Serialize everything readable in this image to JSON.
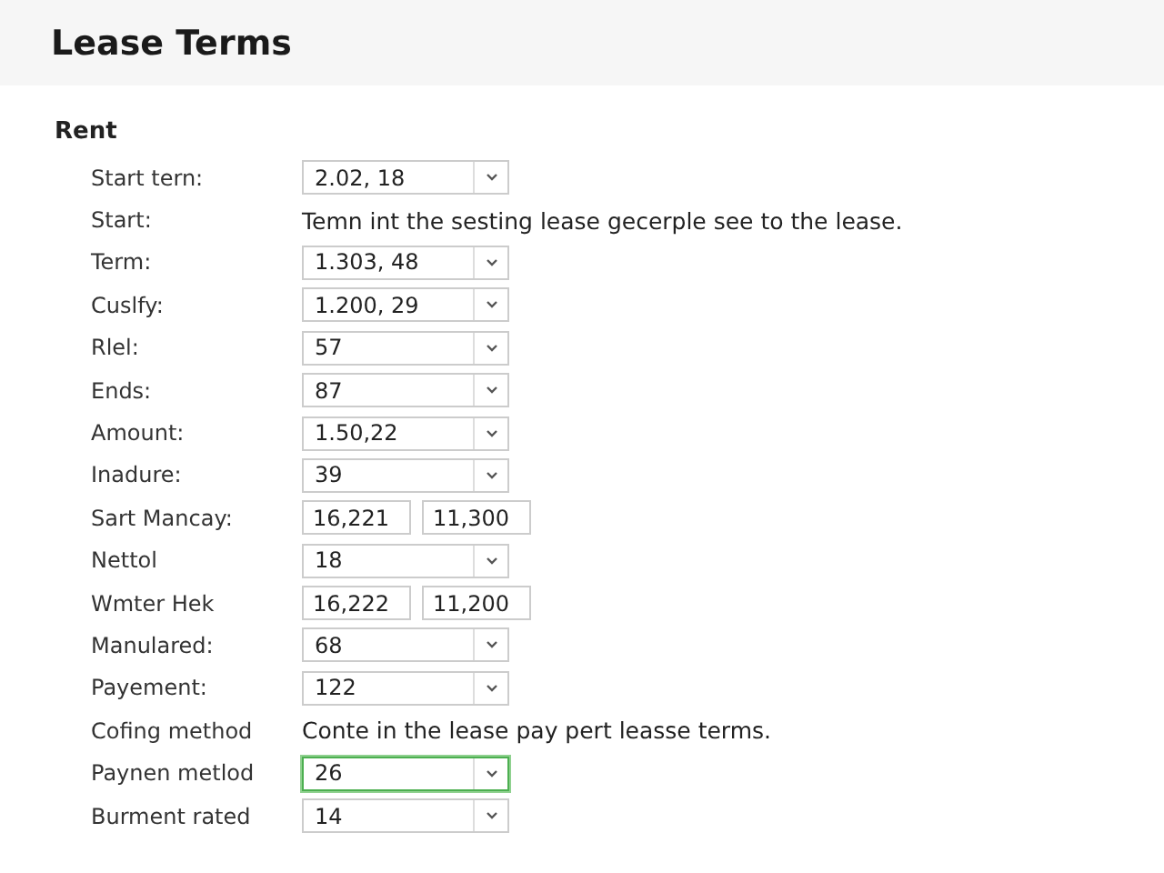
{
  "title": "Lease Terms",
  "section": "Rent",
  "rows": [
    {
      "label": "Start tern:",
      "kind": "select",
      "value": "2.02, 18",
      "focused": false
    },
    {
      "label": "Start:",
      "kind": "text",
      "value": "Temn int the sesting lease gecerple see to the lease."
    },
    {
      "label": "Term:",
      "kind": "select",
      "value": "1.303, 48",
      "focused": false
    },
    {
      "label": "Cuslfy:",
      "kind": "select",
      "value": "1.200, 29",
      "focused": false
    },
    {
      "label": "Rlel:",
      "kind": "select",
      "value": "57",
      "focused": false
    },
    {
      "label": "Ends:",
      "kind": "select",
      "value": "87",
      "focused": false
    },
    {
      "label": "Amount:",
      "kind": "select",
      "value": "1.50,22",
      "focused": false
    },
    {
      "label": "Inadure:",
      "kind": "select",
      "value": "39",
      "focused": false
    },
    {
      "label": "Sart Mancay:",
      "kind": "pair",
      "values": [
        "16,221",
        "11,300"
      ]
    },
    {
      "label": "Nettol",
      "kind": "select",
      "value": "18",
      "focused": false
    },
    {
      "label": "Wmter Hek",
      "kind": "pair",
      "values": [
        "16,222",
        "11,200"
      ]
    },
    {
      "label": "Manulared:",
      "kind": "select",
      "value": "68",
      "focused": false
    },
    {
      "label": "Payement:",
      "kind": "select",
      "value": "122",
      "focused": false
    },
    {
      "label": "Cofing method",
      "kind": "text",
      "value": "Conte in the lease pay pert leasse terms."
    },
    {
      "label": "Paynen metlod",
      "kind": "select",
      "value": "26",
      "focused": true
    },
    {
      "label": "Burment rated",
      "kind": "select",
      "value": "14",
      "focused": false
    }
  ]
}
